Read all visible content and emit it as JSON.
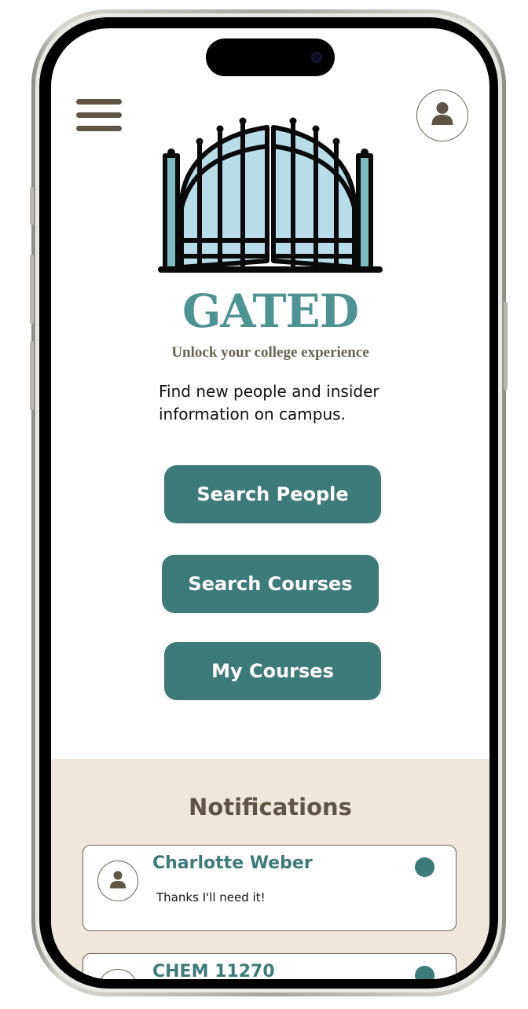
{
  "app": {
    "title": "GATED",
    "tagline": "Unlock your college experience",
    "intro": "Find new people and insider information on campus."
  },
  "actions": {
    "search_people": "Search People",
    "search_courses": "Search Courses",
    "my_courses": "My Courses"
  },
  "notifications": {
    "heading": "Notifications",
    "items": [
      {
        "sender": "Charlotte Weber",
        "message": "Thanks I'll need it!",
        "unread": true
      },
      {
        "sender": "CHEM 11270",
        "message": "",
        "unread": true
      }
    ]
  },
  "icons": {
    "menu": "hamburger-menu-icon",
    "profile": "user-icon",
    "logo": "gate-icon"
  },
  "colors": {
    "primary": "#3e7a78",
    "brand_teal": "#4f9292",
    "text_brown": "#5e5546",
    "panel_beige": "#efe7dc",
    "gate_fill": "#b9dde8"
  }
}
